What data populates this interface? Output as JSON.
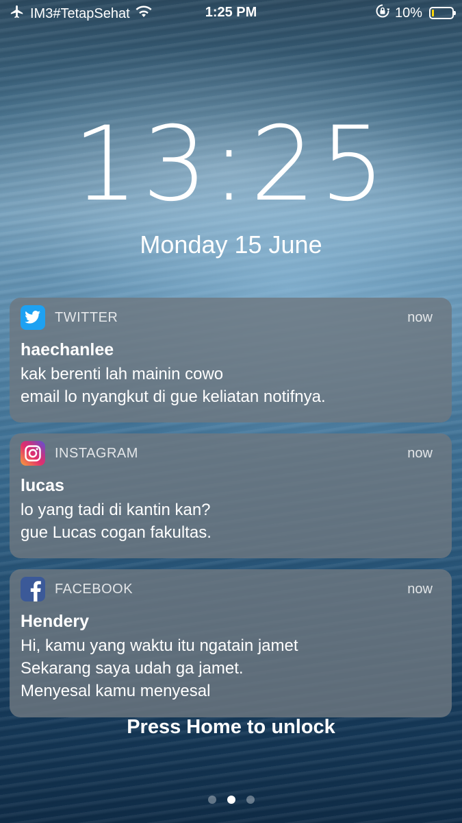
{
  "status_bar": {
    "carrier": "IM3#TetapSehat",
    "time": "1:25 PM",
    "battery_percent": "10%",
    "battery_level": 0.1,
    "battery_color": "#ffd60a",
    "icons": [
      "airplane-icon",
      "wifi-icon",
      "orientation-lock-icon",
      "battery-icon"
    ]
  },
  "lock_screen": {
    "time": "13:25",
    "date": "Monday 15 June",
    "unlock_hint": "Press Home to unlock",
    "page_dots": {
      "count": 3,
      "active_index": 1
    }
  },
  "notifications": [
    {
      "app": "TWITTER",
      "icon": "twitter-icon",
      "icon_color": "#1da1f2",
      "time": "now",
      "title": "haechanlee",
      "lines": [
        "kak berenti lah mainin cowo",
        "email lo nyangkut di gue keliatan notifnya."
      ]
    },
    {
      "app": "INSTAGRAM",
      "icon": "instagram-icon",
      "time": "now",
      "title": "lucas",
      "lines": [
        "lo yang tadi di kantin kan?",
        "gue Lucas cogan fakultas."
      ]
    },
    {
      "app": "FACEBOOK",
      "icon": "facebook-icon",
      "icon_color": "#3b5998",
      "time": "now",
      "title": "Hendery",
      "lines": [
        "Hi, kamu yang waktu itu ngatain jamet",
        "Sekarang saya udah ga jamet.",
        "Menyesal kamu menyesal"
      ]
    }
  ]
}
